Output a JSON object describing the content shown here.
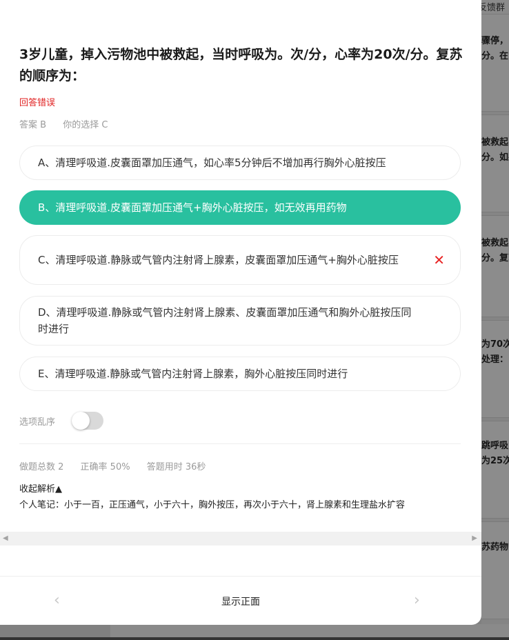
{
  "background": {
    "group_label": "反馈群",
    "snippets": [
      "骤停，",
      "分。在",
      "被救起，",
      "分。如果",
      "被救起，",
      "分。复苏",
      "为70次",
      "处理：",
      "跳呼吸",
      "为25次",
      "苏药物"
    ]
  },
  "question": {
    "title": "3岁儿童，掉入污物池中被救起，当时呼吸为。次/分，心率为20次/分。复苏的顺序为："
  },
  "result": {
    "status": "回答错误",
    "correct_answer": "答案 B",
    "your_choice": "你的选择 C"
  },
  "options": [
    {
      "text": "A、清理呼吸道.皮囊面罩加压通气，如心率5分钟后不增加再行胸外心脏按压"
    },
    {
      "text": "B、清理呼吸道.皮囊面罩加压通气+胸外心脏按压，如无效再用药物"
    },
    {
      "text": "C、清理呼吸道.静脉或气管内注射肾上腺素，皮囊面罩加压通气+胸外心脏按压",
      "wrong_mark": "✕"
    },
    {
      "text": "D、清理呼吸道.静脉或气管内注射肾上腺素、皮囊面罩加压通气和胸外心脏按压同时进行"
    },
    {
      "text": "E、清理呼吸道.静脉或气管内注射肾上腺素，胸外心脏按压同时进行"
    }
  ],
  "colors": {
    "correct": "#29c09f",
    "wrong": "#e82424"
  },
  "settings": {
    "shuffle_label": "选项乱序",
    "shuffle_on": false
  },
  "stats": {
    "total": "做题总数 2",
    "accuracy": "正确率 50%",
    "time": "答题用时 36秒"
  },
  "analysis": {
    "toggle_label": "收起解析▲",
    "notes": "个人笔记：小于一百，正压通气，小于六十，胸外按压，再次小于六十，肾上腺素和生理盐水扩容"
  },
  "footer": {
    "prev_icon": "‹",
    "next_icon": "›",
    "show_front_label": "显示正面"
  }
}
